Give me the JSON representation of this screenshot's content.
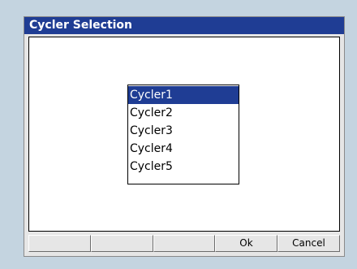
{
  "window": {
    "title": "Cycler Selection"
  },
  "cycler_list": {
    "items": [
      "Cycler1",
      "Cycler2",
      "Cycler3",
      "Cycler4",
      "Cycler5"
    ],
    "selected_index": 0
  },
  "buttons": {
    "button1": "",
    "button2": "",
    "button3": "",
    "ok": "Ok",
    "cancel": "Cancel"
  },
  "colors": {
    "background": "#c4d4e0",
    "title_bar": "#1f3d94",
    "selection": "#1f3d94",
    "window_face": "#e6e6e6"
  }
}
